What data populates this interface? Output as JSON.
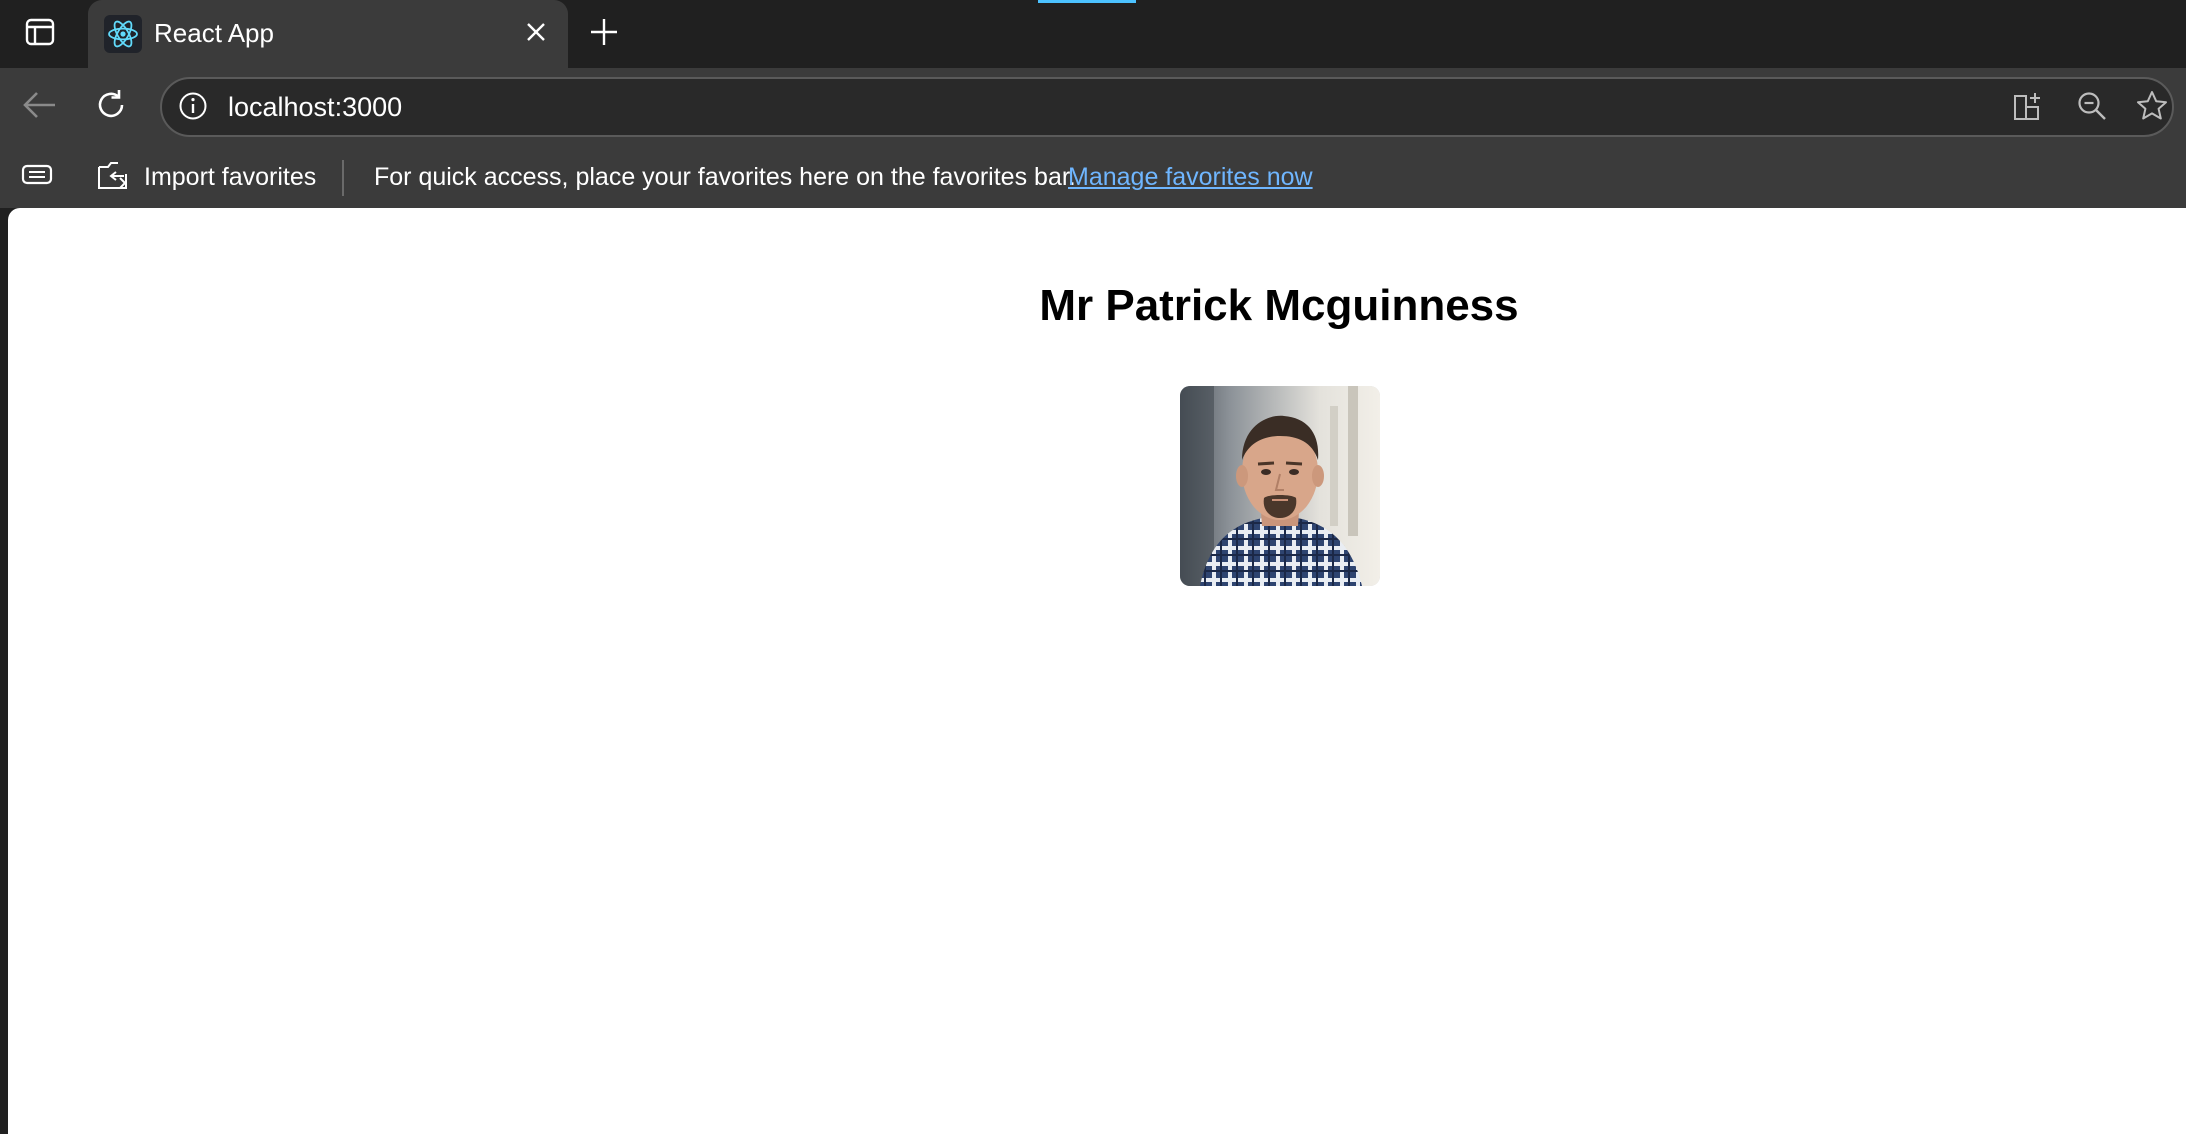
{
  "browser": {
    "tab": {
      "title": "React App",
      "favicon": "react-logo-icon"
    },
    "address_bar": {
      "url": "localhost:3000"
    },
    "favorites_bar": {
      "import_label": "Import favorites",
      "message": "For quick access, place your favorites here on the favorites bar.",
      "manage_link": "Manage favorites now"
    },
    "icons": {
      "tab_actions": "tab-actions-icon",
      "close": "close-icon",
      "new_tab": "plus-icon",
      "back": "back-arrow-icon",
      "reload": "reload-icon",
      "site_info": "info-icon",
      "split_screen": "split-screen-icon",
      "zoom_out": "zoom-out-icon",
      "favorite": "star-icon",
      "collections": "collections-icon",
      "import": "import-icon"
    },
    "colors": {
      "frame": "#202020",
      "toolbar": "#3b3b3b",
      "accent": "#4cc2ff",
      "link": "#6fb6ff"
    }
  },
  "page": {
    "heading": "Mr Patrick Mcguinness",
    "avatar": {
      "kind": "profile-photo"
    }
  }
}
